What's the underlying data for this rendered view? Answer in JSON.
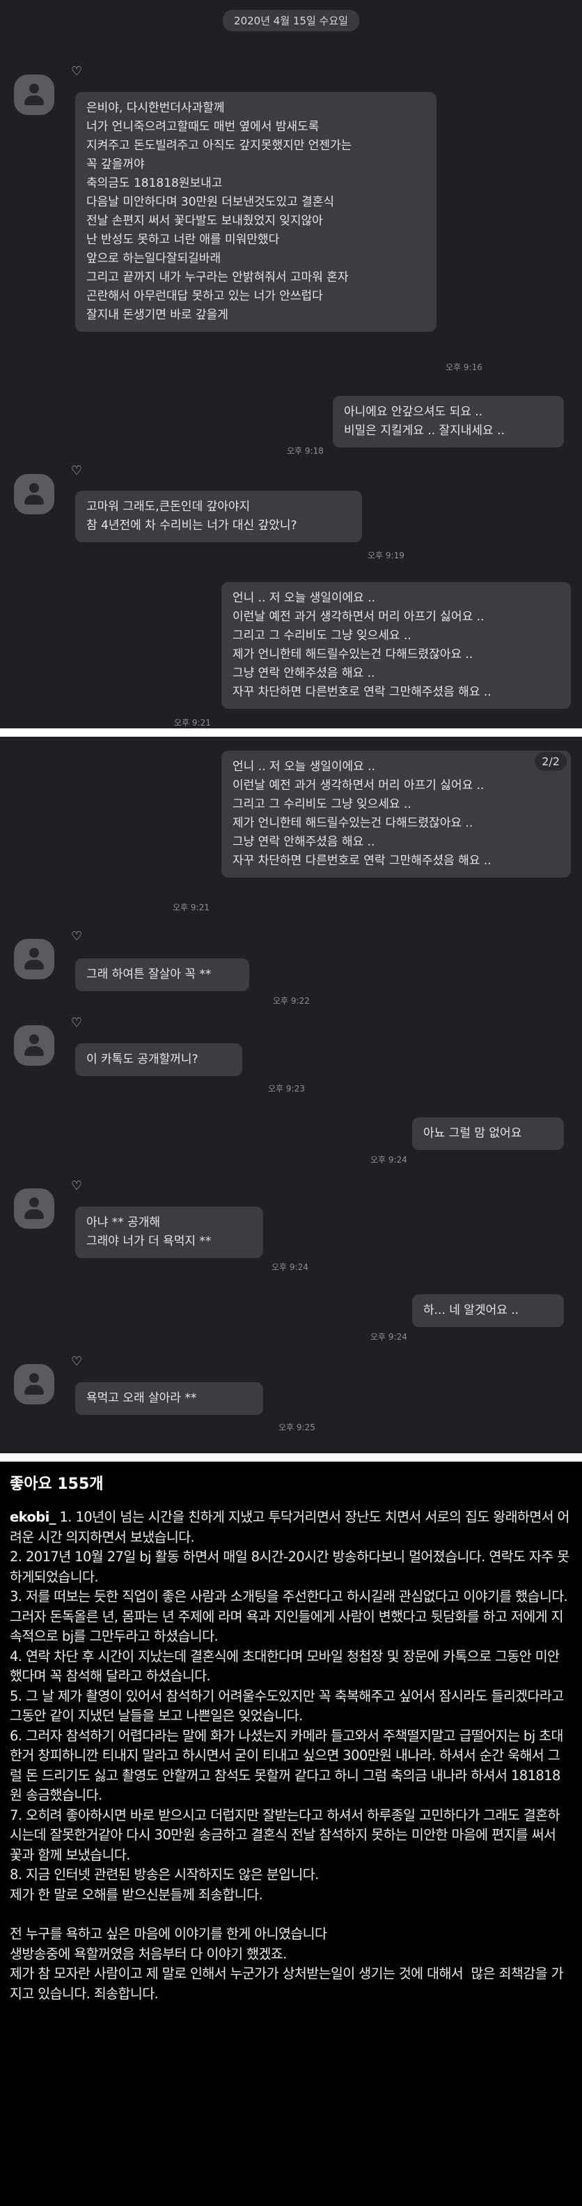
{
  "panel1": {
    "date": "2020년 4월 15일 수요일",
    "msg1": "은비야, 다시한번더사과할께\n너가 언니죽으려고할때도 매번 옆에서 밤새도록\n지켜주고 돈도빌려주고 아직도 갚지못했지만 언젠가는\n꼭 갚을꺼야\n축의금도 181818원보내고\n다음날 미안하다며 30만원 더보낸것도있고 결혼식\n전날 손편지 써서 꽃다발도 보내줬었지 잊지않아\n난 반성도 못하고 너란 애를 미워만했다\n앞으로 하는일다잘되길바래\n그리고 끝까지 내가 누구라는 안밝혀줘서 고마워 혼자\n곤란해서 아무런대답 못하고 있는 너가 안쓰럽다\n잘지내 돈생기면 바로 갚을게",
    "time1": "오후 9:16",
    "reply1": "아니에요 안갚으셔도 되요 ..\n비밀은 지킬게요 .. 잘지내세요 ..",
    "time2": "오후 9:18",
    "msg2": "고마워 그래도,큰돈인데 갚아야지\n참 4년전에 차 수리비는 너가 대신 갚았니?",
    "time3": "오후 9:19",
    "reply2": "언니 .. 저 오늘 생일이에요 ..\n이런날 예전 과거 생각하면서 머리 아프기 싫어요 ..\n그리고 그 수리비도 그냥 잊으세요 ..\n제가 언니한테 해드릴수있는건 다해드렸잖아요 ..\n그냥 연락 안해주셨음 해요 ..\n자꾸 차단하면 다른번호로 연락 그만해주셨음 해요 ..",
    "time4": "오후 9:21"
  },
  "panel2": {
    "counter": "2/2",
    "reply2": "언니 .. 저 오늘 생일이에요 ..\n이런날 예전 과거 생각하면서 머리 아프기 싫어요 ..\n그리고 그 수리비도 그냥 잊으세요 ..\n제가 언니한테 해드릴수있는건 다해드렸잖아요 ..\n그냥 연락 안해주셨음 해요 ..\n자꾸 차단하면 다른번호로 연락 그만해주셨음 해요 ..",
    "time1": "오후 9:21",
    "m1": "그래 하여튼 잘살아 꼭 **",
    "t1": "오후 9:22",
    "m2": "이 카톡도 공개할꺼니?",
    "t2": "오후 9:23",
    "r1": "아뇨 그럴 맘 없어요",
    "t3": "오후 9:24",
    "m3": "아냐 ** 공개해\n그래야 너가 더 욕먹지 **",
    "t4": "오후 9:24",
    "r2": "하... 네 알겟어요 ..",
    "t5": "오후 9:24",
    "m4": "욕먹고 오래 살아라 **",
    "t6": "오후 9:25"
  },
  "post": {
    "likes": "좋아요 155개",
    "username": "ekobi_",
    "p1": " 1. 10년이 넘는 시간을 친하게 지냈고 투닥거리면서 장난도 치면서 서로의 집도 왕래하면서 어려운 시간 의지하면서 보냈습니다.",
    "p2": "2. 2017년 10월 27일 bj 활동 하면서 매일 8시간-20시간 방송하다보니 멀어졌습니다. 연락도 자주 못하게되었습니다.",
    "p3": "3. 저를 떠보는 듯한 직업이 좋은 사람과 소개팅을 주선한다고 하시길래 관심없다고 이야기를 했습니다. 그러자 돈독올른 년, 몸파는 년 주제에 라며 욕과 지인들에게 사람이 변했다고 뒷담화를 하고 저에게 지속적으로 bj를 그만두라고 하셨습니다.",
    "p4": "4. 연락 차단 후 시간이 지났는데 결혼식에 초대한다며 모바일 청첩장 및 장문에 카톡으로 그동안 미안했다며 꼭 참석해 달라고 하셨습니다.",
    "p5": "5. 그 날 제가 촬영이 있어서 참석하기 어려울수도있지만 꼭 축복해주고 싶어서 잠시라도 들리겠다라고 그동안 같이 지냈던 날들을 보고 나쁜일은 잊었습니다.",
    "p6": "6. 그러자 참석하기 어렵다라는 말에 화가 나셨는지 카메라 들고와서 주책떨지말고 급떨어지는 bj 초대한거 창피하니깐 티내지 말라고 하시면서 굳이 티내고 싶으면 300만원 내나라. 하셔서 순간 욱해서 그럴 돈 드리기도 싫고 촬영도 안할꺼고 참석도 못할꺼 같다고 하니 그럼 축의금 내나라 하셔서 181818원 송금했습니다.",
    "p7": "7. 오히려 좋아하시면 바로 받으시고 더럽지만 잘받는다고 하셔서 하루종일 고민하다가 그래도 결혼하시는데 잘못한거같아 다시 30만원 송금하고 결혼식 전날 참석하지 못하는 미안한 마음에 편지를 써서 꽃과 함께 보냈습니다.",
    "p8": "8. 지금 인터넷 관련된 방송은 시작하지도 않은 분입니다.\n제가 한 말로 오해를 받으신분들께 죄송합니다.",
    "p9": "전 누구를 욕하고 싶은 마음에 이야기를 한게 아니였습니다\n생방송중에 욕할꺼였음 처음부터 다 이야기 했겠죠.\n제가 참 모자란 사람이고 제 말로 인해서 누군가가 상처받는일이 생기는 것에 대해서  많은 죄책감을 가지고 있습니다. 죄송합니다."
  }
}
